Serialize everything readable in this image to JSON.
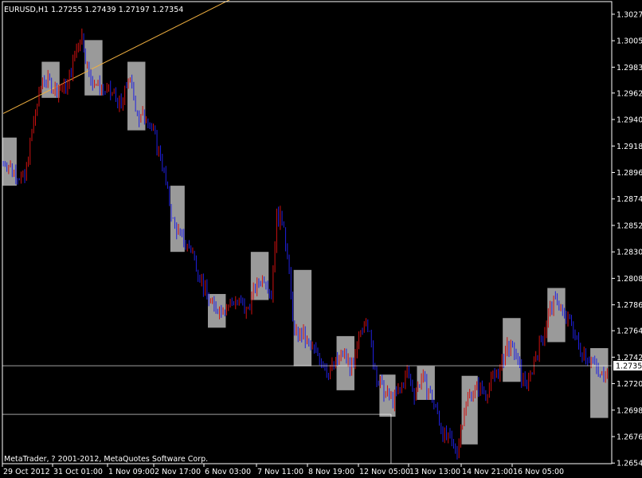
{
  "window": {
    "header": "EURUSD,H1  1.27255 1.27439 1.27197 1.27354",
    "copyright": "MetaTrader, ? 2001-2012, MetaQuotes Software Corp."
  },
  "colors": {
    "background": "#000000",
    "grid": "#ffffff",
    "bull_candle": "#d01010",
    "bear_candle": "#2020e0",
    "box_fill": "#9a9a9a",
    "trendline": "#f0b040",
    "axis_text": "#ffffff",
    "current_price_badge": "#ffffff"
  },
  "chart_data": {
    "type": "candlestick",
    "symbol": "EURUSD",
    "timeframe": "H1",
    "current_price": "1.27354",
    "ylim": [
      1.2654,
      1.3038
    ],
    "y_ticks": [
      "1.30275",
      "1.30055",
      "1.29835",
      "1.29620",
      "1.29400",
      "1.29180",
      "1.28960",
      "1.28740",
      "1.28520",
      "1.28300",
      "1.28080",
      "1.27860",
      "1.27645",
      "1.27425",
      "1.27205",
      "1.26985",
      "1.26765",
      "1.26545"
    ],
    "x_ticks": [
      "29 Oct 2012",
      "31 Oct 01:00",
      "1 Nov 09:00",
      "2 Nov 17:00",
      "6 Nov 03:00",
      "7 Nov 11:00",
      "8 Nov 19:00",
      "12 Nov 05:00",
      "13 Nov 13:00",
      "14 Nov 21:00",
      "16 Nov 05:00"
    ],
    "horizontal_lines": [
      1.27354,
      1.2695
    ],
    "vertical_line_at_bar": 217,
    "trendline": {
      "start": [
        0,
        1.2945
      ],
      "end": [
        205,
        1.3098
      ]
    },
    "shaded_boxes": [
      {
        "start": 0,
        "end": 7,
        "low": 1.2885,
        "high": 1.2925
      },
      {
        "start": 22,
        "end": 31,
        "low": 1.2958,
        "high": 1.2988
      },
      {
        "start": 46,
        "end": 55,
        "low": 1.296,
        "high": 1.3006
      },
      {
        "start": 70,
        "end": 79,
        "low": 1.2931,
        "high": 1.2988
      },
      {
        "start": 94,
        "end": 101,
        "low": 1.283,
        "high": 1.2885
      },
      {
        "start": 115,
        "end": 124,
        "low": 1.2767,
        "high": 1.2795
      },
      {
        "start": 139,
        "end": 148,
        "low": 1.279,
        "high": 1.283
      },
      {
        "start": 163,
        "end": 172,
        "low": 1.2735,
        "high": 1.2815
      },
      {
        "start": 187,
        "end": 196,
        "low": 1.2715,
        "high": 1.276
      },
      {
        "start": 211,
        "end": 219,
        "low": 1.2693,
        "high": 1.2728
      },
      {
        "start": 232,
        "end": 241,
        "low": 1.2707,
        "high": 1.2735
      },
      {
        "start": 257,
        "end": 265,
        "low": 1.267,
        "high": 1.2727
      },
      {
        "start": 280,
        "end": 289,
        "low": 1.2722,
        "high": 1.2775
      },
      {
        "start": 305,
        "end": 314,
        "low": 1.2755,
        "high": 1.28
      },
      {
        "start": 329,
        "end": 338,
        "low": 1.2692,
        "high": 1.275
      }
    ],
    "close_path": [
      [
        0,
        1.2905
      ],
      [
        8,
        1.2895
      ],
      [
        12,
        1.289
      ],
      [
        16,
        1.293
      ],
      [
        22,
        1.2975
      ],
      [
        30,
        1.2965
      ],
      [
        36,
        1.2968
      ],
      [
        42,
        1.3005
      ],
      [
        44,
        1.301
      ],
      [
        48,
        1.2975
      ],
      [
        55,
        1.2965
      ],
      [
        62,
        1.296
      ],
      [
        66,
        1.295
      ],
      [
        70,
        1.2975
      ],
      [
        76,
        1.294
      ],
      [
        80,
        1.2945
      ],
      [
        88,
        1.291
      ],
      [
        95,
        1.2855
      ],
      [
        100,
        1.284
      ],
      [
        106,
        1.283
      ],
      [
        112,
        1.28
      ],
      [
        118,
        1.2783
      ],
      [
        124,
        1.2785
      ],
      [
        130,
        1.279
      ],
      [
        136,
        1.278
      ],
      [
        141,
        1.28
      ],
      [
        146,
        1.281
      ],
      [
        150,
        1.2795
      ],
      [
        153,
        1.286
      ],
      [
        157,
        1.2855
      ],
      [
        160,
        1.281
      ],
      [
        163,
        1.276
      ],
      [
        167,
        1.2762
      ],
      [
        171,
        1.2752
      ],
      [
        176,
        1.2745
      ],
      [
        182,
        1.273
      ],
      [
        190,
        1.2745
      ],
      [
        196,
        1.2732
      ],
      [
        200,
        1.2765
      ],
      [
        203,
        1.2778
      ],
      [
        207,
        1.274
      ],
      [
        210,
        1.2722
      ],
      [
        214,
        1.2712
      ],
      [
        218,
        1.2707
      ],
      [
        222,
        1.2715
      ],
      [
        226,
        1.273
      ],
      [
        230,
        1.2712
      ],
      [
        234,
        1.2725
      ],
      [
        238,
        1.2715
      ],
      [
        242,
        1.27
      ],
      [
        246,
        1.268
      ],
      [
        250,
        1.2672
      ],
      [
        254,
        1.2665
      ],
      [
        258,
        1.27
      ],
      [
        262,
        1.2715
      ],
      [
        266,
        1.2718
      ],
      [
        270,
        1.2712
      ],
      [
        274,
        1.2725
      ],
      [
        278,
        1.2732
      ],
      [
        282,
        1.2752
      ],
      [
        286,
        1.2748
      ],
      [
        290,
        1.2725
      ],
      [
        294,
        1.272
      ],
      [
        298,
        1.2745
      ],
      [
        302,
        1.276
      ],
      [
        306,
        1.2785
      ],
      [
        310,
        1.279
      ],
      [
        314,
        1.2775
      ],
      [
        318,
        1.277
      ],
      [
        322,
        1.275
      ],
      [
        326,
        1.2745
      ],
      [
        330,
        1.2738
      ],
      [
        334,
        1.2725
      ],
      [
        338,
        1.2735
      ]
    ]
  }
}
